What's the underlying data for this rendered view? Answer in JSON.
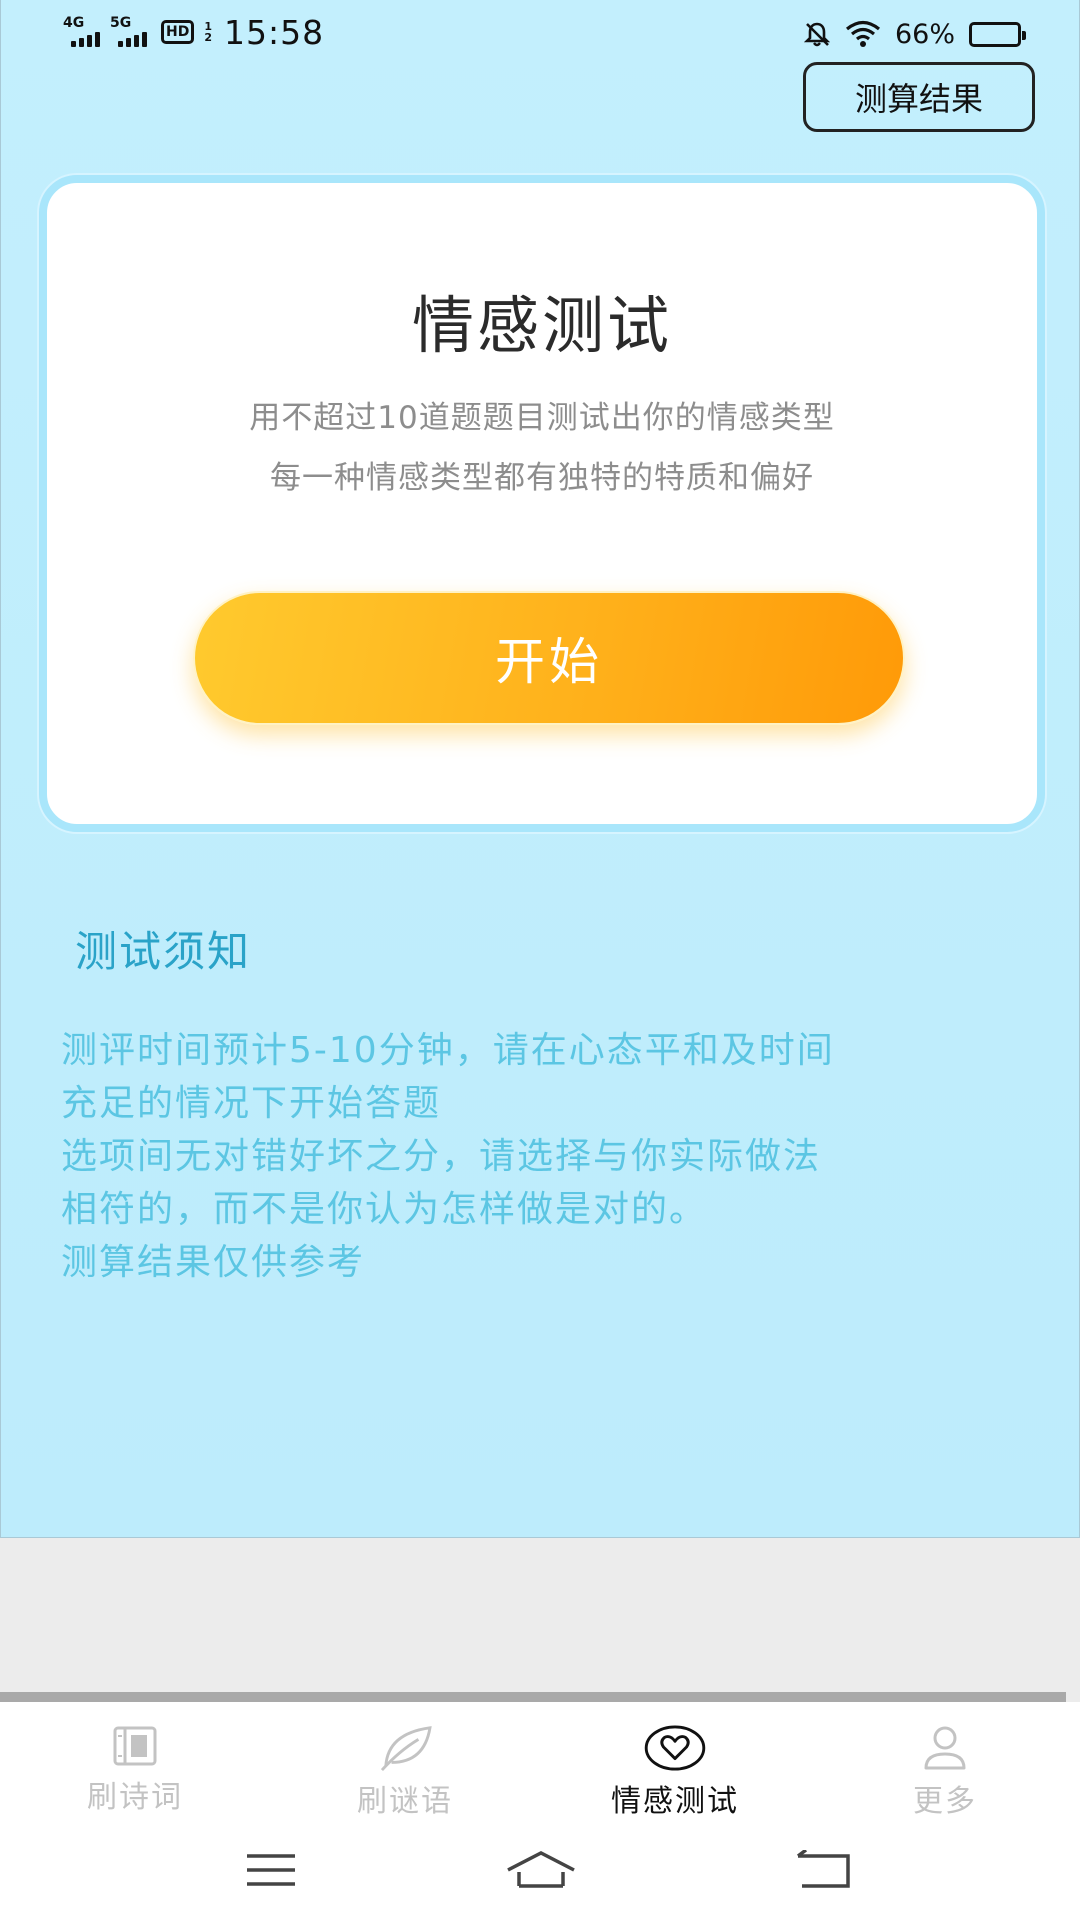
{
  "status_bar": {
    "network1": "4G",
    "network2": "5G",
    "hd_label": "HD",
    "hd_sub1": "1",
    "hd_sub2": "2",
    "time": "15:58",
    "battery_percent": "66%",
    "battery_level": 0.66
  },
  "header": {
    "result_button_label": "测算结果"
  },
  "card": {
    "title": "情感测试",
    "description_lines": [
      "用不超过10道题题目测试出你的情感类型",
      "每一种情感类型都有独特的特质和偏好"
    ],
    "start_button_label": "开始"
  },
  "notice": {
    "title": "测试须知",
    "lines": [
      "测评时间预计5-10分钟，请在心态平和及时间",
      "充足的情况下开始答题",
      "选项间无对错好坏之分，请选择与你实际做法",
      "相符的，而不是你认为怎样做是对的。",
      "测算结果仅供参考"
    ]
  },
  "tab_bar": {
    "tabs": [
      {
        "label": "刷诗词",
        "icon": "book-icon",
        "active": false
      },
      {
        "label": "刷谜语",
        "icon": "leaf-icon",
        "active": false
      },
      {
        "label": "情感测试",
        "icon": "heart-icon",
        "active": true
      },
      {
        "label": "更多",
        "icon": "user-icon",
        "active": false
      }
    ]
  },
  "nav_bar": {
    "icons": [
      "menu-icon",
      "home-icon",
      "back-icon"
    ]
  },
  "colors": {
    "background": "#c3effd",
    "accent_orange": "#ffb11b",
    "notice_title": "#2aa3c8",
    "notice_text": "#5cc6e3",
    "active_tab": "#111111",
    "inactive_tab": "#c3c3c3"
  }
}
